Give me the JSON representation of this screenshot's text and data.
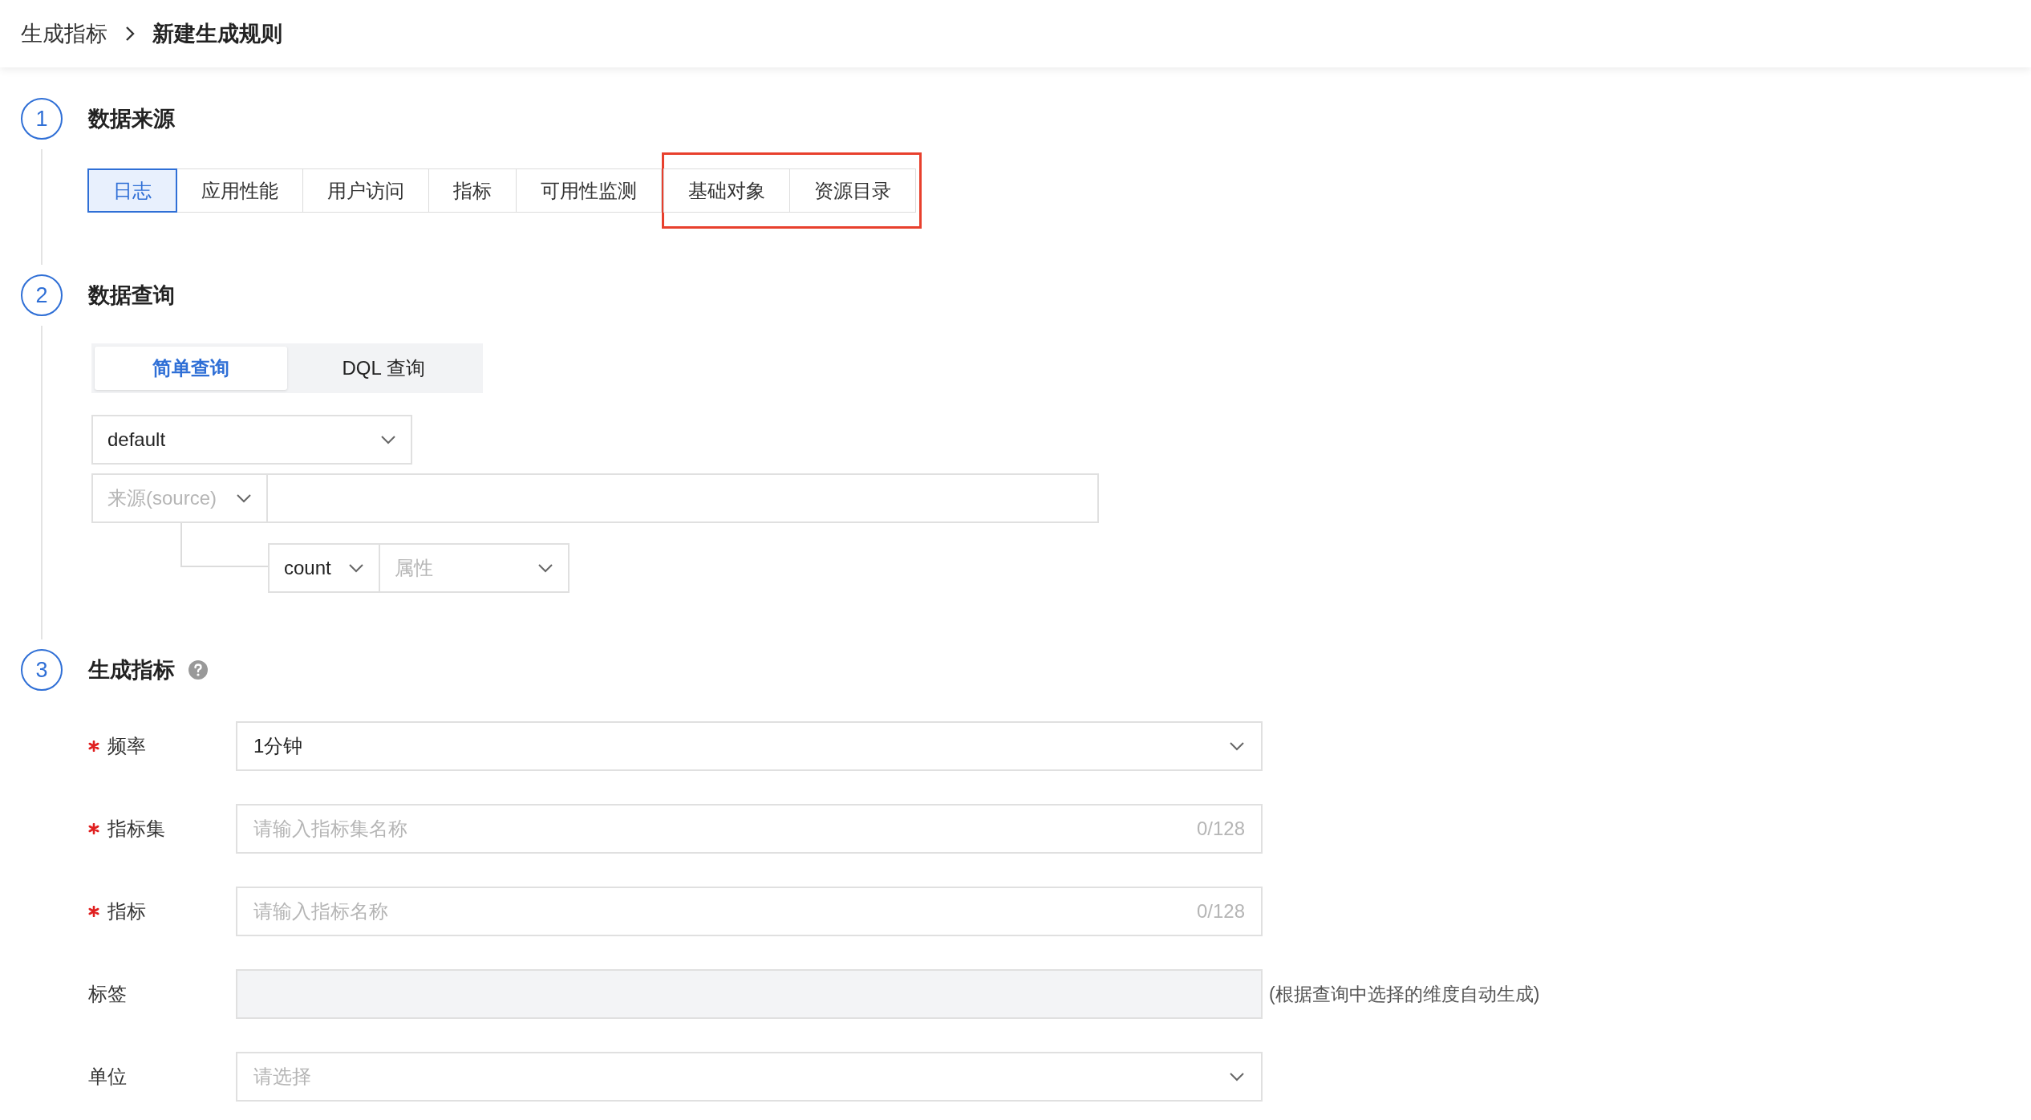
{
  "breadcrumb": [
    {
      "label": "生成指标"
    },
    {
      "label": "新建生成规则"
    }
  ],
  "steps": [
    {
      "number": "1",
      "title": "数据来源",
      "help": false
    },
    {
      "number": "2",
      "title": "数据查询",
      "help": false
    },
    {
      "number": "3",
      "title": "生成指标",
      "help": true
    }
  ],
  "data_source": {
    "tabs": [
      {
        "label": "日志",
        "selected": true,
        "highlighted": false
      },
      {
        "label": "应用性能",
        "selected": false,
        "highlighted": false
      },
      {
        "label": "用户访问",
        "selected": false,
        "highlighted": false
      },
      {
        "label": "指标",
        "selected": false,
        "highlighted": false
      },
      {
        "label": "可用性监测",
        "selected": false,
        "highlighted": false
      },
      {
        "label": "基础对象",
        "selected": false,
        "highlighted": true
      },
      {
        "label": "资源目录",
        "selected": false,
        "highlighted": true
      }
    ]
  },
  "query": {
    "mode_tabs": [
      {
        "label": "简单查询",
        "selected": true
      },
      {
        "label": "DQL 查询",
        "selected": false
      }
    ],
    "workspace": {
      "value": "default"
    },
    "source": {
      "placeholder": "来源(source)"
    },
    "aggregate": {
      "function": "count",
      "attribute_placeholder": "属性"
    }
  },
  "metric_form": [
    {
      "kind": "select",
      "label": "频率",
      "required": true,
      "value": "1分钟"
    },
    {
      "kind": "input",
      "label": "指标集",
      "required": true,
      "placeholder": "请输入指标集名称",
      "counter": "0/128"
    },
    {
      "kind": "input",
      "label": "指标",
      "required": true,
      "placeholder": "请输入指标名称",
      "counter": "0/128"
    },
    {
      "kind": "readonly",
      "label": "标签",
      "required": false,
      "note": "(根据查询中选择的维度自动生成)"
    },
    {
      "kind": "select",
      "label": "单位",
      "required": false,
      "placeholder": "请选择"
    }
  ]
}
